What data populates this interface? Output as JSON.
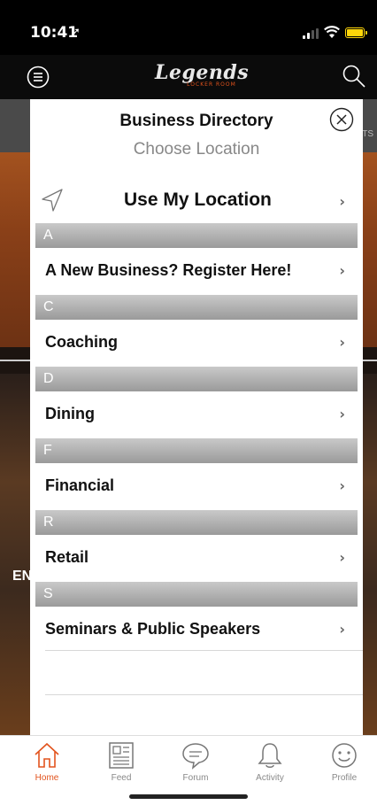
{
  "status": {
    "time": "10:41",
    "location_arrow": "➚"
  },
  "app_nav": {
    "logo_main": "Legends",
    "logo_sub": "LOCKER ROOM",
    "menu_icon": "hamburger-circle-icon",
    "search_icon": "search-icon"
  },
  "background": {
    "tab_fragment": "TS",
    "text_fragment": "EN"
  },
  "modal": {
    "title": "Business Directory",
    "subtitle": "Choose Location",
    "close_icon": "close-circle-icon",
    "use_location": {
      "label": "Use My Location",
      "icon": "location-arrow-icon"
    },
    "sections": [
      {
        "header": "A",
        "items": [
          "A New Business? Register Here!"
        ]
      },
      {
        "header": "C",
        "items": [
          "Coaching"
        ]
      },
      {
        "header": "D",
        "items": [
          "Dining"
        ]
      },
      {
        "header": "F",
        "items": [
          "Financial"
        ]
      },
      {
        "header": "R",
        "items": [
          "Retail"
        ]
      },
      {
        "header": "S",
        "items": [
          "Seminars & Public Speakers"
        ]
      }
    ],
    "chevron": "›"
  },
  "tabs": [
    {
      "label": "Home",
      "icon": "home-icon",
      "active": true
    },
    {
      "label": "Feed",
      "icon": "feed-icon",
      "active": false
    },
    {
      "label": "Forum",
      "icon": "forum-icon",
      "active": false
    },
    {
      "label": "Activity",
      "icon": "bell-icon",
      "active": false
    },
    {
      "label": "Profile",
      "icon": "smiley-icon",
      "active": false
    }
  ],
  "colors": {
    "accent": "#e2531d",
    "battery": "#ffd60a",
    "section_header": "#a8a8a8"
  }
}
